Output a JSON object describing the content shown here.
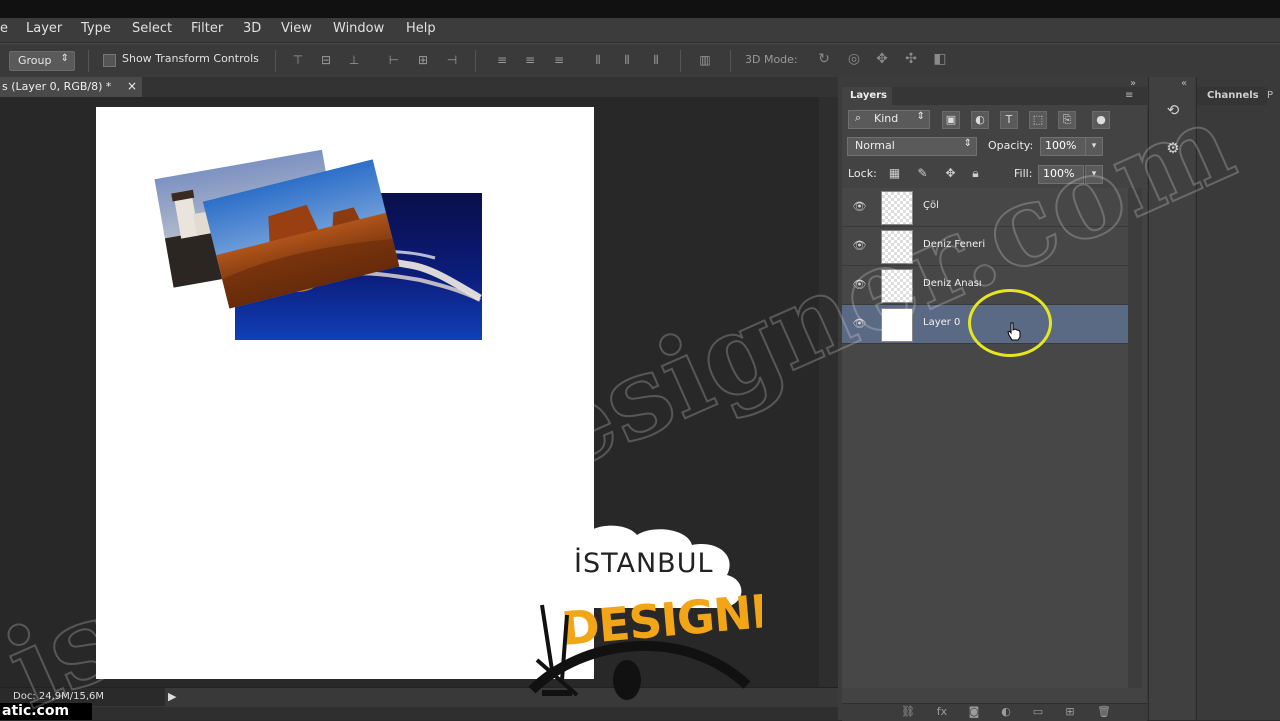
{
  "menu": [
    "e",
    "Layer",
    "Type",
    "Select",
    "Filter",
    "3D",
    "View",
    "Window",
    "Help"
  ],
  "options_bar": {
    "auto_select_value": "Group",
    "show_transform_label": "Show Transform Controls",
    "mode_label": "3D Mode:"
  },
  "document_tab": {
    "title": "s (Layer 0, RGB/8) *",
    "close_glyph": "×"
  },
  "status": {
    "doc_size": "Doc: 24,9M/15,6M",
    "arrow_glyph": "▶"
  },
  "layers_panel": {
    "tab_label": "Layers",
    "kind_label": "Kind",
    "blend_mode": "Normal",
    "opacity_label": "Opacity:",
    "opacity_value": "100%",
    "lock_label": "Lock:",
    "fill_label": "Fill:",
    "fill_value": "100%",
    "layers": [
      {
        "name": "Çöl",
        "visible": true,
        "selected": false
      },
      {
        "name": "Deniz Feneri",
        "visible": true,
        "selected": false
      },
      {
        "name": "Deniz Anası",
        "visible": true,
        "selected": false
      },
      {
        "name": "Layer 0",
        "visible": true,
        "selected": true
      }
    ]
  },
  "right_panel": {
    "channels_label": "Channels"
  },
  "overlays": {
    "watermark_text": "istanbuldesigner.com",
    "site_fragment": "atic.com",
    "logo_line1": "İSTANBUL",
    "logo_line2": "DESIGNER"
  },
  "colors": {
    "selection_highlight": "#5b6a84",
    "cursor_ring": "#e6e620",
    "logo_orange": "#f2a516"
  }
}
